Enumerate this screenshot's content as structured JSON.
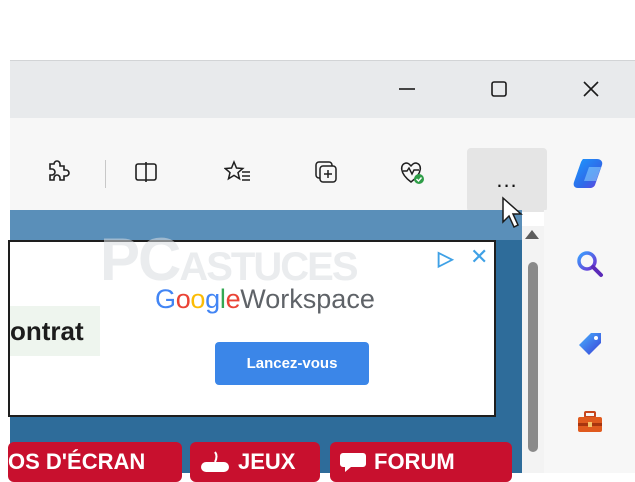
{
  "toolbar": {
    "more_label": "..."
  },
  "ad": {
    "contract_text": "ontrat",
    "brand_google": "Google",
    "brand_product": " Workspace",
    "cta_label": "Lancez-vous",
    "close_label": "✕"
  },
  "watermark": {
    "text1": "PC",
    "text2": "ASTUCES"
  },
  "nav": {
    "items": [
      {
        "label": "OS D'ÉCRAN"
      },
      {
        "label": "JEUX"
      },
      {
        "label": "FORUM"
      }
    ]
  },
  "colors": {
    "accent_blue": "#3b86e8",
    "nav_red": "#c8102e",
    "page_bg": "#2e6c9a",
    "google_blue": "#4285F4",
    "google_red": "#EA4335",
    "google_yellow": "#FBBC05",
    "google_green": "#34A853"
  },
  "icons": {
    "extensions": "puzzle-icon",
    "split": "split-screen-icon",
    "favorites": "favorites-icon",
    "collections": "collections-icon",
    "health": "browser-essentials-icon",
    "copilot": "copilot-icon",
    "search": "search-icon",
    "shopping": "shopping-tag-icon",
    "tools": "toolbox-icon"
  }
}
